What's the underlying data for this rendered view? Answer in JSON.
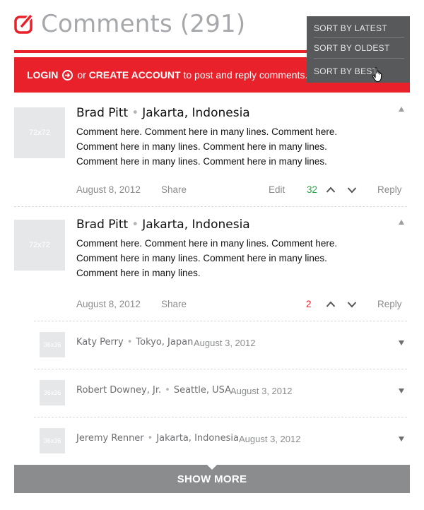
{
  "header": {
    "title": "Comments (291)"
  },
  "banner": {
    "login": "LOGIN",
    "or": "or",
    "create_account": "CREATE ACCOUNT",
    "suffix": "to post and reply comments."
  },
  "sort_menu": {
    "items": [
      "SORT BY LATEST",
      "SORT BY OLDEST",
      "SORT BY BEST"
    ]
  },
  "comments": [
    {
      "avatar": "72x72",
      "name": "Brad Pitt",
      "location": "Jakarta, Indonesia",
      "body": "Comment here. Comment here in many lines. Comment here. Comment here in many lines. Comment here in many lines. Comment here in many lines. Comment here in many lines.",
      "date": "August 8, 2012",
      "share": "Share",
      "edit": "Edit",
      "votes": "32",
      "reply": "Reply"
    },
    {
      "avatar": "72x72",
      "name": "Brad Pitt",
      "location": "Jakarta, Indonesia",
      "body": "Comment here. Comment here in many lines. Comment here. Comment here in many lines. Comment here in many lines. Comment here in many lines.",
      "date": "August 8, 2012",
      "share": "Share",
      "votes": "2",
      "reply": "Reply"
    }
  ],
  "collapsed": [
    {
      "avatar": "36x36",
      "name": "Katy Perry",
      "location": "Tokyo, Japan",
      "date": "August 3, 2012"
    },
    {
      "avatar": "36x36",
      "name": "Robert Downey, Jr.",
      "location": "Seattle, USA",
      "date": "August 3, 2012"
    },
    {
      "avatar": "36x36",
      "name": "Jeremy Renner",
      "location": "Jakarta, Indonesia",
      "date": "August 3, 2012"
    }
  ],
  "show_more": "SHOW MORE",
  "colors": {
    "brand": "#e8212a",
    "upvote_count": "#28a745",
    "gray": "#8a8c8e"
  }
}
